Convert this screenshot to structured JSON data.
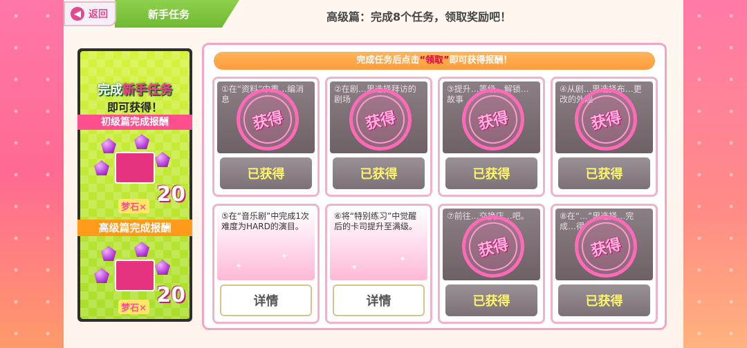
{
  "header": {
    "back_label": "返回",
    "title": "新手任务",
    "message": "高级篇：完成8个任务，领取奖励吧！"
  },
  "banner": {
    "line1_a": "完成",
    "line1_b": "新手任务",
    "line2": "即可获得！",
    "beginner_label": "初级篇完成报酬",
    "reward_label": "梦石×",
    "reward_amount": "20",
    "advanced_label": "高级篇完成报酬",
    "reward2_label": "梦石×",
    "reward2_amount": "20"
  },
  "notice": {
    "lead": "完成任务后点击",
    "quote": "“领取”",
    "tail": "即可获得报酬！"
  },
  "tasks": [
    {
      "desc": "①在“资料”中重…编消息",
      "status": "已获得",
      "stamp": "获得"
    },
    {
      "desc": "②在剧…里选择拜访的剧场",
      "status": "已获得",
      "stamp": "获得"
    },
    {
      "desc": "③提升…等级，解锁…故事",
      "status": "已获得",
      "stamp": "获得"
    },
    {
      "desc": "④从剧…里选择布…更改的外观",
      "status": "已获得",
      "stamp": "获得"
    },
    {
      "desc": "⑤在“音乐剧”中完成1次难度为HARD的演目。",
      "status": "详情",
      "stamp": ""
    },
    {
      "desc": "⑥将“特别练习”中觉醒后的卡司提升至满级。",
      "status": "详情",
      "stamp": ""
    },
    {
      "desc": "⑦前往…交换店…吧。",
      "status": "已获得",
      "stamp": "获得"
    },
    {
      "desc": "⑧在“…”里选择…完成…得",
      "status": "已获得",
      "stamp": "获得"
    }
  ]
}
